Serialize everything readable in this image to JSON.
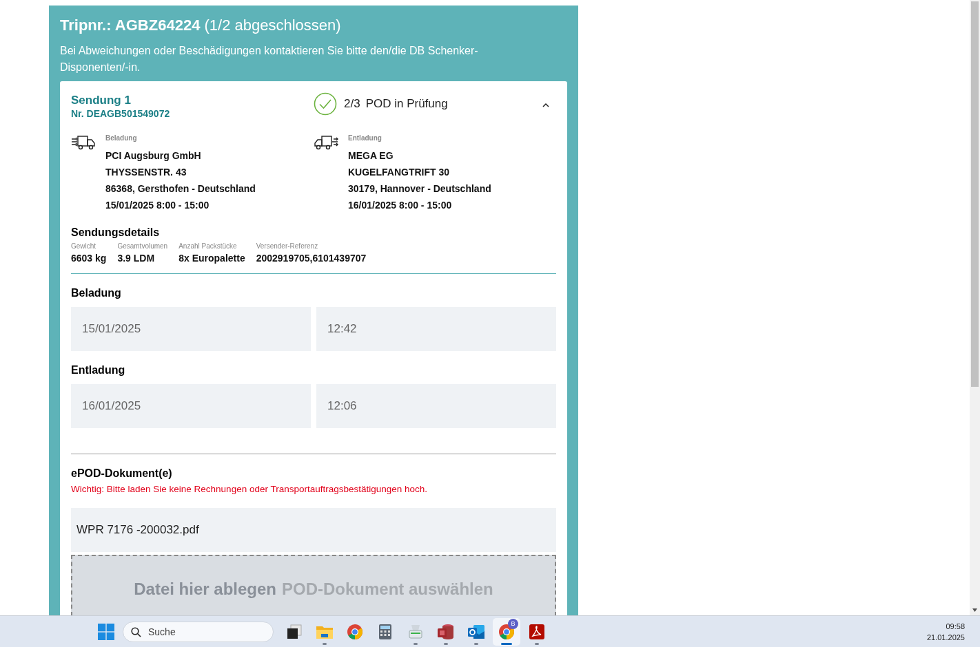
{
  "header": {
    "title": "**Tripnr.: AGBZ64224** (1/2 abgeschlossen)",
    "notice": "Bei Abweichungen oder Beschädigungen kontaktieren Sie bitte den/die DB Schenker-Disponenten/-in."
  },
  "shipment": {
    "title": "Sendung 1",
    "number": "Nr. DEAGB501549072",
    "expanded": true,
    "status": {
      "done": true,
      "count": "2/3",
      "text": "POD in Prüfung"
    },
    "stops": [
      {
        "kind": "loading",
        "label": "Beladung",
        "lines": [
          "PCI Augsburg GmbH",
          "THYSSENSTR. 43",
          "86368, Gersthofen - Deutschland",
          "15/01/2025 8:00 - 15:00"
        ]
      },
      {
        "kind": "unloading",
        "label": "Entladung",
        "lines": [
          "MEGA EG",
          "KUGELFANGTRIFT 30",
          "30179, Hannover - Deutschland",
          "16/01/2025 8:00 - 15:00"
        ]
      }
    ],
    "details": {
      "title": "Sendungsdetails",
      "fields": [
        {
          "label": "Gewicht",
          "value": "6603 kg"
        },
        {
          "label": "Gesamtvolumen",
          "value": "3.9 LDM"
        },
        {
          "label": "Anzahl Packstücke",
          "value": "8x Europalette"
        },
        {
          "label": "Versender-Referenz",
          "value": "2002919705,6101439707"
        }
      ]
    },
    "times": [
      {
        "title": "Beladung",
        "date": "15/01/2025",
        "time": "12:42"
      },
      {
        "title": "Entladung",
        "date": "16/01/2025",
        "time": "12:06"
      }
    ],
    "documents": {
      "title": "ePOD-Dokument(e)",
      "warning": "Wichtig: Bitte laden Sie keine Rechnungen oder Transportauftragsbestätigungen hoch.",
      "files": [
        "WPR 7176 -200032.pdf"
      ],
      "dropzone": {
        "text": "Datei hier ablegen",
        "link": "POD-Dokument auswählen"
      }
    }
  },
  "taskbar": {
    "search_placeholder": "Suche",
    "apps": [
      {
        "kind": "taskview",
        "running": false,
        "selected": false
      },
      {
        "kind": "folder",
        "running": true,
        "selected": false
      },
      {
        "kind": "browser",
        "running": false,
        "selected": false
      },
      {
        "kind": "calculator",
        "running": false,
        "selected": false
      },
      {
        "kind": "scanner",
        "running": true,
        "selected": false
      },
      {
        "kind": "database",
        "running": true,
        "selected": false
      },
      {
        "kind": "mail",
        "running": true,
        "selected": false
      },
      {
        "kind": "browser",
        "running": true,
        "selected": true,
        "badge": "B"
      },
      {
        "kind": "pdf",
        "running": true,
        "selected": false
      }
    ],
    "clock": {
      "time": "09:58",
      "date": "21.01.2025"
    }
  }
}
